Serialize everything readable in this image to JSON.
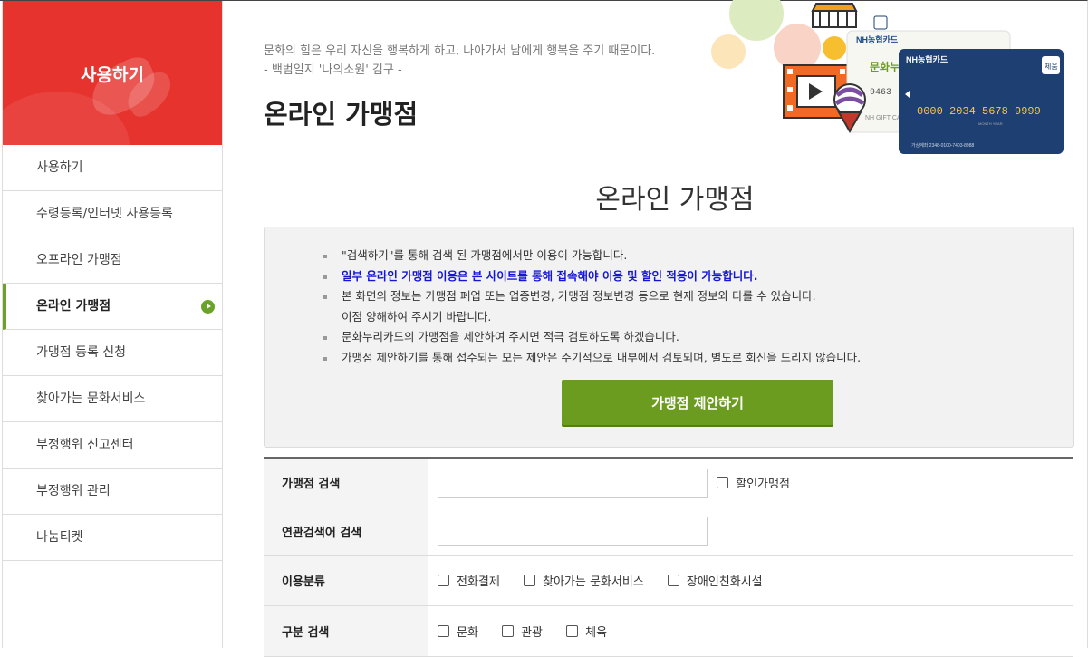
{
  "sidebar": {
    "title": "사용하기",
    "items": [
      {
        "label": "사용하기"
      },
      {
        "label": "수령등록/인터넷 사용등록"
      },
      {
        "label": "오프라인 가맹점"
      },
      {
        "label": "온라인 가맹점",
        "active": true
      },
      {
        "label": "가맹점 등록 신청"
      },
      {
        "label": "찾아가는 문화서비스"
      },
      {
        "label": "부정행위 신고센터"
      },
      {
        "label": "부정행위 관리"
      },
      {
        "label": "나눔티켓"
      }
    ]
  },
  "header": {
    "quote_line1": "문화의 힘은 우리 자신을 행복하게 하고, 나아가서 남에게 행복을 주기 때문이다.",
    "quote_line2": "- 백범일지 '나의소원' 김구 -",
    "page_title": "온라인 가맹점",
    "card_brand": "NH농협카드",
    "card_number": "0000 2034 5678 9999",
    "card_badge": "체움",
    "card_small_text": "MONTH YEAR",
    "card_bottom_text": "가상계좌 2348-0100-7403-8988",
    "card2_label": "문화누리",
    "card2_sub": "NH GIFT CARD",
    "card2_num": "9463"
  },
  "content": {
    "title": "온라인 가맹점",
    "notices": [
      "\"검색하기\"를 통해 검색 된 가맹점에서만 이용이 가능합니다.",
      "일부 온라인 가맹점 이용은 본 사이트를 통해 접속해야 이용 및 할인 적용이 가능합니다.",
      "본 화면의 정보는 가맹점 폐업 또는 업종변경, 가맹점 정보변경 등으로 현재 정보와 다를 수 있습니다.",
      "이점 양해하여 주시기 바랍니다.",
      "문화누리카드의 가맹점을 제안하여 주시면 적극 검토하도록 하겠습니다.",
      "가맹점 제안하기를 통해 접수되는 모든 제안은 주기적으로 내부에서 검토되며, 별도로 회신을 드리지 않습니다."
    ],
    "suggest_button": "가맹점 제안하기"
  },
  "search": {
    "store_label": "가맹점 검색",
    "store_value": "",
    "discount_label": "할인가맹점",
    "related_label": "연관검색어 검색",
    "related_value": "",
    "usage_label": "이용분류",
    "usage_options": [
      "전화결제",
      "찾아가는 문화서비스",
      "장애인친화시설"
    ],
    "category_label": "구분 검색",
    "category_options": [
      "문화",
      "관광",
      "체육"
    ]
  },
  "colors": {
    "sidebar_header": "#e6332e",
    "accent_green": "#6b9c1f",
    "notice_blue": "#1515d8"
  }
}
